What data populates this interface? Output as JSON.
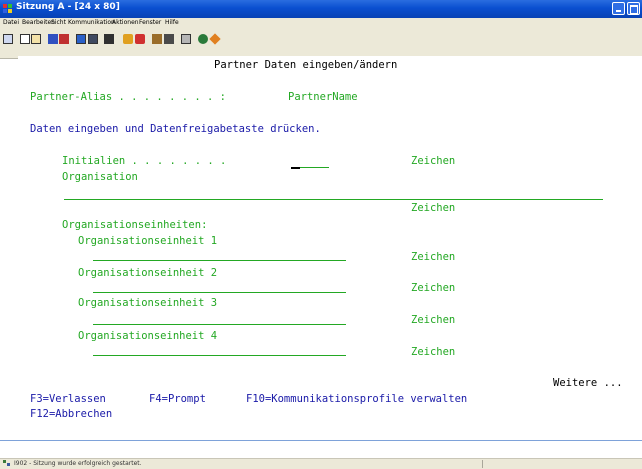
{
  "window": {
    "title": "Sitzung A - [24 x 80]"
  },
  "menu": [
    "Datei",
    "Bearbeiten",
    "Sicht",
    "Kommunikation",
    "Aktionen",
    "Fenster",
    "Hilfe"
  ],
  "toolbar_icons": [
    "print-screen-icon",
    "copy-icon",
    "paste-icon",
    "send-icon",
    "receive-icon",
    "display-icon",
    "keyboard-icon",
    "color-icon",
    "macro-record-icon",
    "macro-stop-icon",
    "macro-play-icon",
    "transfer-icon",
    "save-icon",
    "globe-icon",
    "key-icon"
  ],
  "screen": {
    "title": "Partner Daten eingeben/ändern",
    "alias_label": "Partner-Alias . . . . . . . . :",
    "alias_value": "PartnerName",
    "instruction": "Daten eingeben und Datenfreigabetaste drücken.",
    "initialien_label": "Initialien . . . . . . . .",
    "organisation_label": "Organisation",
    "units_label": "Organisationseinheiten:",
    "unit_labels": [
      "Organisationseinheit 1",
      "Organisationseinheit 2",
      "Organisationseinheit 3",
      "Organisationseinheit 4"
    ],
    "zeichen": "Zeichen",
    "more": "Weitere ...",
    "fkeys": {
      "f3": "F3=Verlassen",
      "f4": "F4=Prompt",
      "f10": "F10=Kommunikationsprofile verwalten",
      "f12": "F12=Abbrechen"
    }
  },
  "status": {
    "text": "I902 - Sitzung wurde erfolgreich gestartet."
  }
}
